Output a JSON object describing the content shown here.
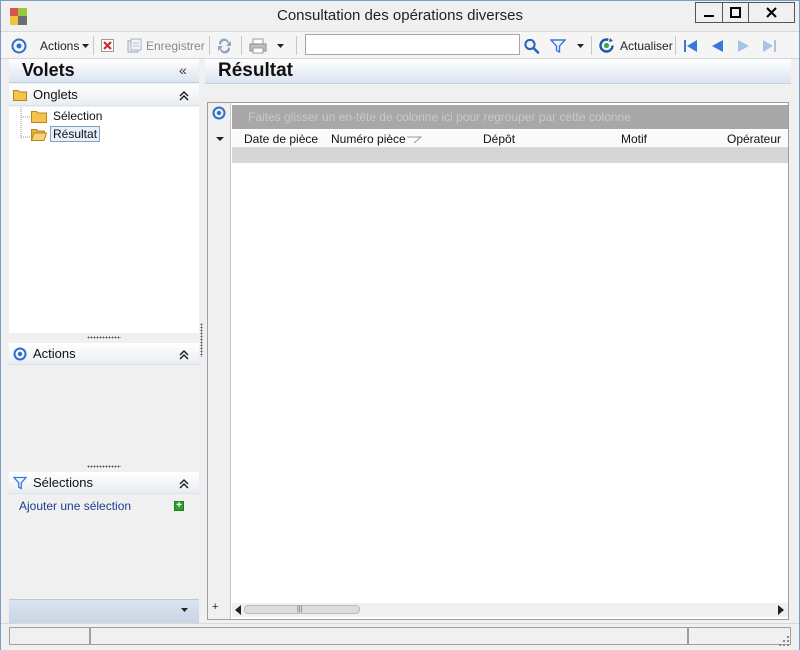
{
  "window": {
    "title": "Consultation des opérations diverses",
    "controls": {
      "minimize": "—",
      "maximize": "□",
      "close": "✕"
    }
  },
  "toolbar": {
    "actions_label": "Actions",
    "save_label": "Enregistrer",
    "refresh_label": "Actualiser",
    "search": {
      "value": "",
      "placeholder": ""
    }
  },
  "left_panel": {
    "header": "Volets",
    "collapse_glyph": "«",
    "tabs_section": {
      "title": "Onglets",
      "items": [
        {
          "label": "Sélection",
          "selected": false
        },
        {
          "label": "Résultat",
          "selected": true
        }
      ]
    },
    "actions_section": {
      "title": "Actions"
    },
    "selections_section": {
      "title": "Sélections",
      "add_link": "Ajouter une sélection"
    }
  },
  "right_panel": {
    "header": "Résultat",
    "group_bar_text": "Faites glisser un en-tête de colonne ici pour regrouper par cette colonne",
    "columns": [
      {
        "label": "Date de pièce"
      },
      {
        "label": "Numéro pièce"
      },
      {
        "label": "Dépôt"
      },
      {
        "label": "Motif"
      },
      {
        "label": "Opérateur"
      }
    ]
  },
  "colors": {
    "header_gradient_end": "#dbe4f0",
    "link": "#1c3c8c",
    "nav_arrow": "#3a78d8",
    "group_bar": "#a8a8a8"
  }
}
